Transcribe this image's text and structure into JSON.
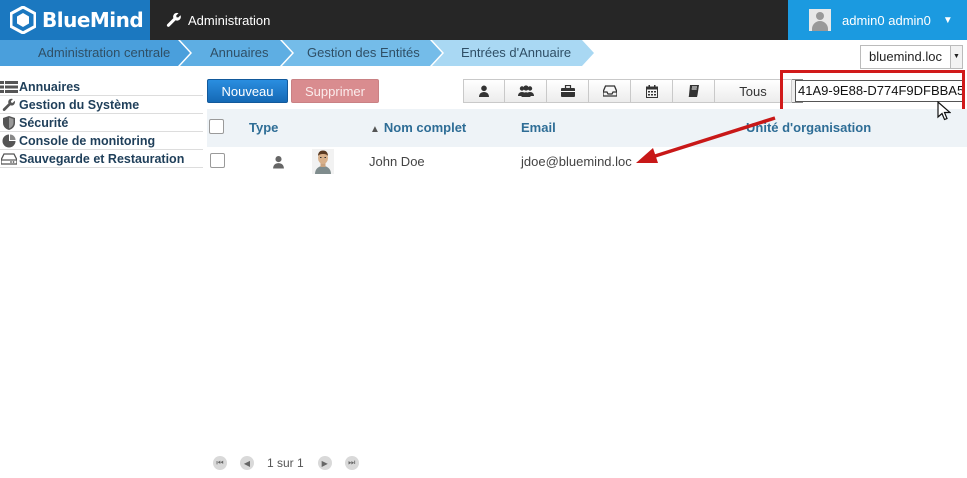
{
  "app": {
    "brand": "BlueMind",
    "section": "Administration"
  },
  "user": {
    "name": "admin0 admin0"
  },
  "breadcrumb": [
    "Administration centrale",
    "Annuaires",
    "Gestion des Entités",
    "Entrées d'Annuaire"
  ],
  "domain_select": {
    "value": "bluemind.loc"
  },
  "sidebar": {
    "items": [
      {
        "label": "Annuaires",
        "icon": "list-icon"
      },
      {
        "label": "Gestion du Système",
        "icon": "wrench-icon"
      },
      {
        "label": "Sécurité",
        "icon": "shield-icon"
      },
      {
        "label": "Console de monitoring",
        "icon": "pie-chart-icon"
      },
      {
        "label": "Sauvegarde et Restauration",
        "icon": "drive-icon"
      }
    ]
  },
  "toolbar": {
    "new_label": "Nouveau",
    "delete_label": "Supprimer",
    "filter_icons": [
      "user-icon",
      "group-icon",
      "briefcase-icon",
      "inbox-icon",
      "calendar-icon",
      "book-icon"
    ],
    "filter_all_label": "Tous",
    "search_value": "41A9-9E88-D774F9DFBBA5"
  },
  "table": {
    "columns": [
      "Type",
      "Nom complet",
      "Email",
      "Unité d'organisation"
    ],
    "sort_indicator": "▲",
    "rows": [
      {
        "type_icon": "user-icon",
        "full_name": "John Doe",
        "email": "jdoe@bluemind.loc",
        "org_unit": ""
      }
    ]
  },
  "pager": {
    "label": "1 sur 1"
  },
  "colors": {
    "brand_blue": "#1b78c0",
    "user_blue": "#1b9ae0",
    "annotation_red": "#d11a1a"
  }
}
